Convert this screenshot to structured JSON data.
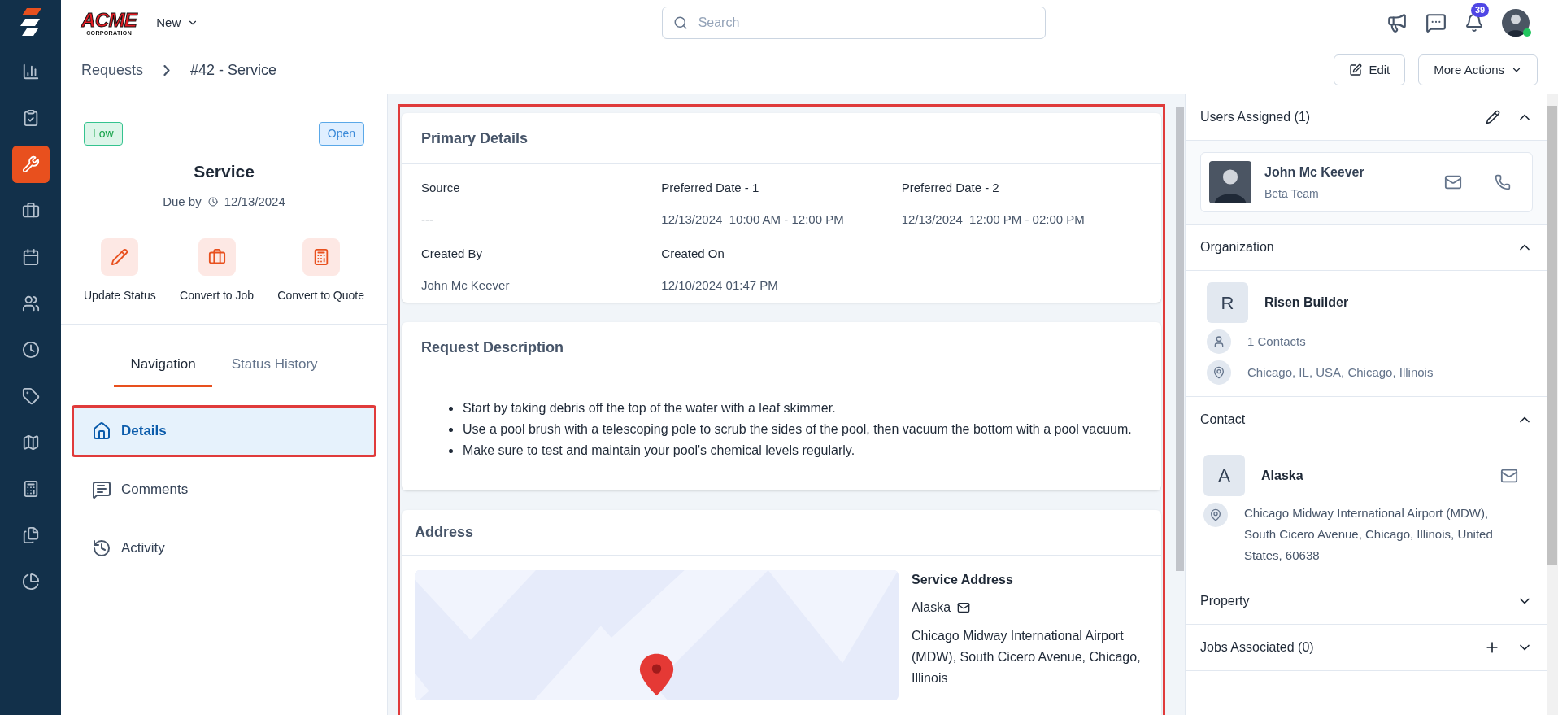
{
  "logo": {
    "title": "ACME",
    "subtitle": "CORPORATION"
  },
  "new_menu": "New",
  "search": {
    "placeholder": "Search"
  },
  "notifications": {
    "count": "39"
  },
  "user_online": true,
  "sidebar": {
    "items": [
      {
        "kind": "chart",
        "selected": false
      },
      {
        "kind": "clipboard",
        "selected": false
      },
      {
        "kind": "wrench",
        "selected": true
      },
      {
        "kind": "briefcase",
        "selected": false
      },
      {
        "kind": "calendar",
        "selected": false
      },
      {
        "kind": "users",
        "selected": false
      },
      {
        "kind": "clock",
        "selected": false
      },
      {
        "kind": "tag",
        "selected": false
      },
      {
        "kind": "map",
        "selected": false
      },
      {
        "kind": "calculator",
        "selected": false
      },
      {
        "kind": "files",
        "selected": false
      },
      {
        "kind": "pie",
        "selected": false
      }
    ]
  },
  "breadcrumb": [
    "Requests",
    "#42 - Service"
  ],
  "header_actions": [
    {
      "label": "Edit",
      "kind": "edit"
    },
    {
      "label": "More Actions",
      "kind": "dropdown"
    }
  ],
  "summary": {
    "priority": "Low",
    "status": "Open",
    "title": "Service",
    "due_label": "Due by",
    "due_date": "12/13/2024",
    "actions": [
      {
        "label": "Update Status",
        "kind": "pencil"
      },
      {
        "label": "Convert to Job",
        "kind": "briefcase"
      },
      {
        "label": "Convert to Quote",
        "kind": "calculator"
      }
    ]
  },
  "tabs": [
    {
      "label": "Navigation",
      "selected": true
    },
    {
      "label": "Status History",
      "selected": false
    }
  ],
  "nav_items": [
    {
      "label": "Details",
      "kind": "home",
      "selected": true,
      "outlined": true
    },
    {
      "label": "Comments",
      "kind": "comment",
      "selected": false,
      "outlined": false
    },
    {
      "label": "Activity",
      "kind": "history",
      "selected": false,
      "outlined": false
    }
  ],
  "main_outlined": true,
  "primary_details": {
    "title": "Primary Details",
    "fields": [
      {
        "label": "Source",
        "value": "---"
      },
      {
        "label": "Preferred Date - 1",
        "value": "12/13/2024  10:00 AM - 12:00 PM"
      },
      {
        "label": "Preferred Date - 2",
        "value": "12/13/2024  12:00 PM - 02:00 PM"
      },
      {
        "label": "Created By",
        "value": "John Mc Keever"
      },
      {
        "label": "Created On",
        "value": "12/10/2024 01:47 PM"
      }
    ]
  },
  "request_description": {
    "title": "Request Description",
    "items": [
      "Start by taking debris off the top of the water with a leaf skimmer.",
      "Use a pool brush with a telescoping pole to scrub the sides of the pool, then vacuum the bottom with a pool vacuum.",
      "Make sure to test and maintain your pool's chemical levels regularly."
    ]
  },
  "address": {
    "title": "Address",
    "heading": "Service Address",
    "contact": "Alaska",
    "text": "Chicago Midway International Airport (MDW), South Cicero Avenue, Chicago, Illinois"
  },
  "right_sections": [
    {
      "kind": "users",
      "title": "Users Assigned (1)",
      "expanded": true,
      "name": "John Mc Keever",
      "subtitle": "Beta Team"
    },
    {
      "kind": "organization",
      "title": "Organization",
      "expanded": true,
      "initial": "R",
      "name": "Risen Builder",
      "contacts": "1 Contacts",
      "location": "Chicago, IL, USA, Chicago, Illinois"
    },
    {
      "kind": "contact",
      "title": "Contact",
      "expanded": true,
      "initial": "A",
      "name": "Alaska",
      "location": "Chicago Midway International Airport (MDW), South Cicero Avenue, Chicago, Illinois, United States, 60638"
    },
    {
      "kind": "plain",
      "title": "Property",
      "expanded": false
    },
    {
      "kind": "add",
      "title": "Jobs Associated (0)",
      "expanded": false
    }
  ]
}
